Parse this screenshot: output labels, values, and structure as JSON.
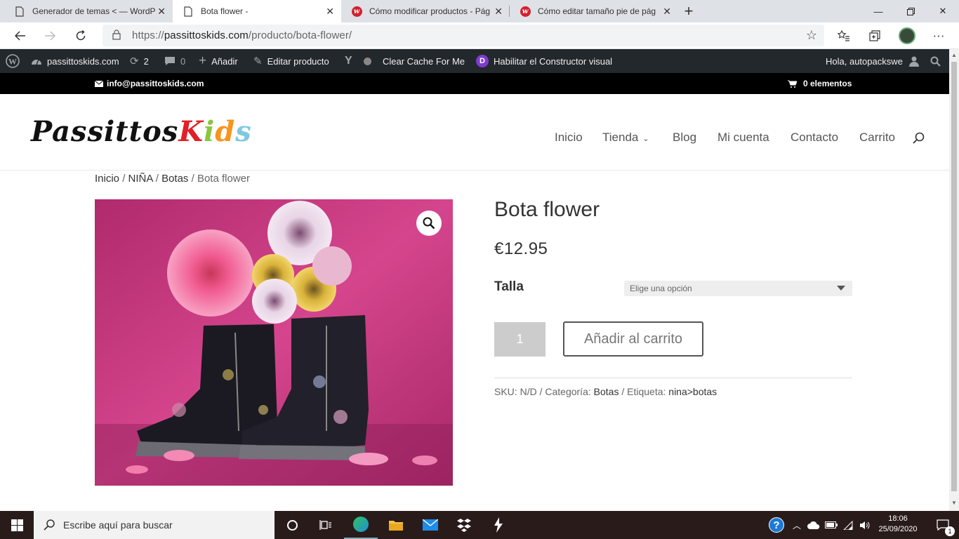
{
  "browser": {
    "tabs": [
      {
        "title": "Generador de temas < — WordP",
        "icon": "page-icon",
        "active": false
      },
      {
        "title": "Bota flower -",
        "icon": "page-icon",
        "active": true
      },
      {
        "title": "Cómo modificar productos - Pág",
        "icon": "w-logo-icon",
        "active": false
      },
      {
        "title": "Cómo editar tamaño pie de pág",
        "icon": "w-logo-icon",
        "active": false
      }
    ],
    "url_scheme": "https://",
    "url_host": "passittoskids.com",
    "url_path": "/producto/bota-flower/"
  },
  "adminbar": {
    "site_name": "passittoskids.com",
    "updates_count": "2",
    "comments_count": "0",
    "add_label": "Añadir",
    "edit_label": "Editar producto",
    "cache_label": "Clear Cache For Me",
    "builder_label": "Habilitar el Constructor visual",
    "greeting": "Hola, autopackswe"
  },
  "topheader": {
    "email": "info@passittoskids.com",
    "cart": "0 elementos"
  },
  "header": {
    "logo_part1": "Passittos",
    "logo_part2": "Kids",
    "nav": [
      "Inicio",
      "Tienda",
      "Blog",
      "Mi cuenta",
      "Contacto",
      "Carrito"
    ]
  },
  "breadcrumb": {
    "items": [
      "Inicio",
      "NIÑA",
      "Botas"
    ],
    "sep": "/",
    "current": "Bota flower"
  },
  "product": {
    "title": "Bota flower",
    "price": "€12.95",
    "talla_label": "Talla",
    "talla_placeholder": "Elige una opción",
    "quantity": "1",
    "add_to_cart": "Añadir al carrito",
    "sku_label": "SKU:",
    "sku_value": "N/D",
    "category_label": "Categoría:",
    "category_value": "Botas",
    "tag_label": "Etiqueta:",
    "tag_value": "nina>botas"
  },
  "taskbar": {
    "search_placeholder": "Escribe aquí para buscar",
    "time": "18:06",
    "date": "25/09/2020",
    "notification_count": "1"
  },
  "colors": {
    "adminbar_bg": "#23282d",
    "logo_k": "#e21e26",
    "logo_i": "#8cc63f",
    "logo_d": "#f7941d",
    "logo_s": "#7ec8e3",
    "image_bg": "#c63a7e"
  }
}
